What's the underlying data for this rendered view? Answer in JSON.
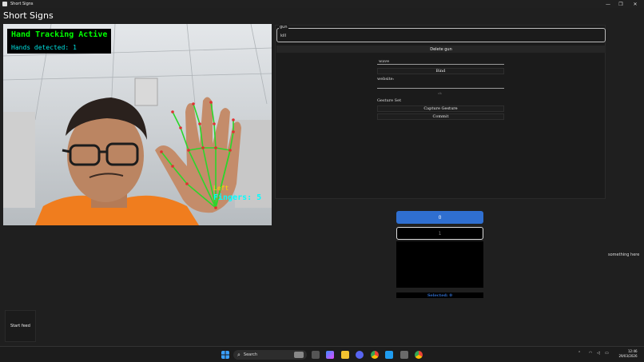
{
  "window": {
    "title": "Short Signs",
    "controls": {
      "minimize": "—",
      "maximize": "❐",
      "close": "✕"
    }
  },
  "app": {
    "heading": "Short Signs"
  },
  "video": {
    "overlay_title": "Hand Tracking Active",
    "hands_detected": "Hands detected: 1",
    "hand_label": "Left",
    "fingers_label": "Fingers: 5"
  },
  "gesture_panel": {
    "legend": "gun",
    "value": "kill",
    "delete_label": "Delete gun"
  },
  "bind_form": {
    "gesture_input_value": "wave",
    "bind_label": "Bind",
    "website_label": "website:",
    "website_value": "",
    "status_text": "ok",
    "gesture_set_label": "Gesture Set",
    "capture_label": "Capture Gesture",
    "commit_label": "Commit"
  },
  "selector": {
    "option_0": "0",
    "option_1": "1",
    "selected_text": "Selected: 0"
  },
  "side_note": "something here",
  "start_feed_label": "Start feed",
  "taskbar": {
    "search_label": "Search",
    "time": "12:46",
    "date": "29/03/2026"
  },
  "colors": {
    "accent": "#2f6fd1",
    "overlay_green": "#00ff00",
    "overlay_cyan": "#00ffff",
    "hand_label_yellow": "#ffd800"
  }
}
